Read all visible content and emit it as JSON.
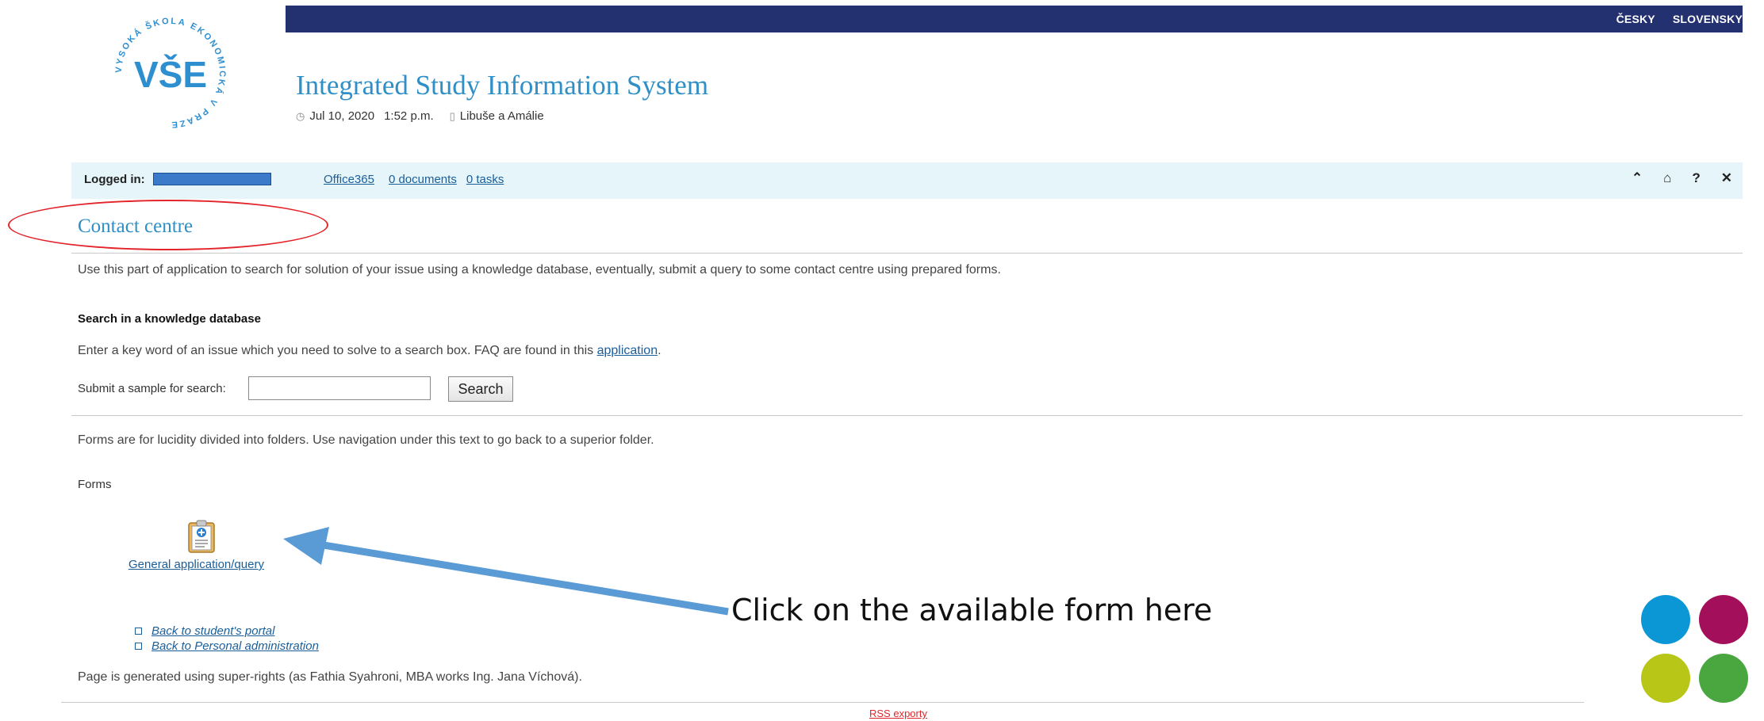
{
  "languages": [
    "ČESKY",
    "SLOVENSKY"
  ],
  "logo": {
    "emblem": "VŠE",
    "ring_text": "VYSOKÁ ŠKOLA EKONOMICKÁ V PRAZE"
  },
  "header": {
    "title": "Integrated Study Information System",
    "date": "Jul 10, 2020",
    "time": "1:52 p.m.",
    "nameday": "Libuše a Amálie"
  },
  "loginbar": {
    "logged_in_label": "Logged in:",
    "links": [
      "Office365",
      "0 documents",
      "0 tasks"
    ],
    "tools": [
      {
        "icon": "chevron-up-icon",
        "glyph": "⌃"
      },
      {
        "icon": "home-icon",
        "glyph": "⌂"
      },
      {
        "icon": "help-icon",
        "glyph": "?"
      },
      {
        "icon": "close-icon",
        "glyph": "✕"
      }
    ]
  },
  "page": {
    "title": "Contact centre",
    "intro": "Use this part of application to search for solution of your issue using a knowledge database, eventually, submit a query to some contact centre using prepared forms.",
    "search_heading": "Search in a knowledge database",
    "search_desc_prefix": "Enter a key word of an issue which you need to solve to a search box. FAQ are found in this",
    "search_desc_link": "application",
    "search_label": "Submit a sample for search:",
    "search_value": "",
    "search_button": "Search",
    "forms_desc": "Forms are for lucidity divided into folders. Use navigation under this text to go back to a superior folder.",
    "forms_heading": "Forms",
    "form_item": "General application/query",
    "back_links": [
      "Back to student's portal",
      "Back to Personal administration"
    ],
    "footer_note": "Page is generated using super-rights (as Fathia Syahroni, MBA works Ing. Jana Víchová).",
    "rss": "RSS exporty"
  },
  "annotation": {
    "text": "Click on the available form here",
    "arrow_color": "#5b9bd5",
    "ellipse_color": "#e3242b"
  },
  "brand_dots": [
    "#0b96d6",
    "#a40f5c",
    "#b8c617",
    "#4aa63f"
  ]
}
